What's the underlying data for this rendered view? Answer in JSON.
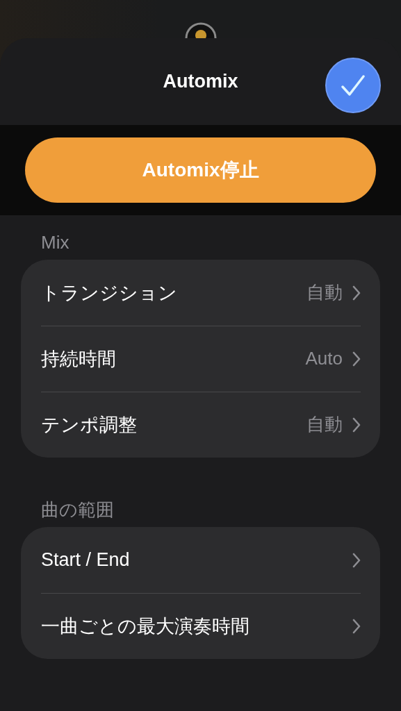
{
  "header": {
    "title": "Automix",
    "confirm": true
  },
  "primary_button": {
    "label": "Automix停止"
  },
  "sections": [
    {
      "title": "Mix",
      "rows": [
        {
          "label": "トランジション",
          "value": "自動"
        },
        {
          "label": "持続時間",
          "value": "Auto"
        },
        {
          "label": "テンポ調整",
          "value": "自動"
        }
      ]
    },
    {
      "title": "曲の範囲",
      "rows": [
        {
          "label": "Start / End"
        },
        {
          "label": "一曲ごとの最大演奏時間"
        }
      ]
    }
  ]
}
